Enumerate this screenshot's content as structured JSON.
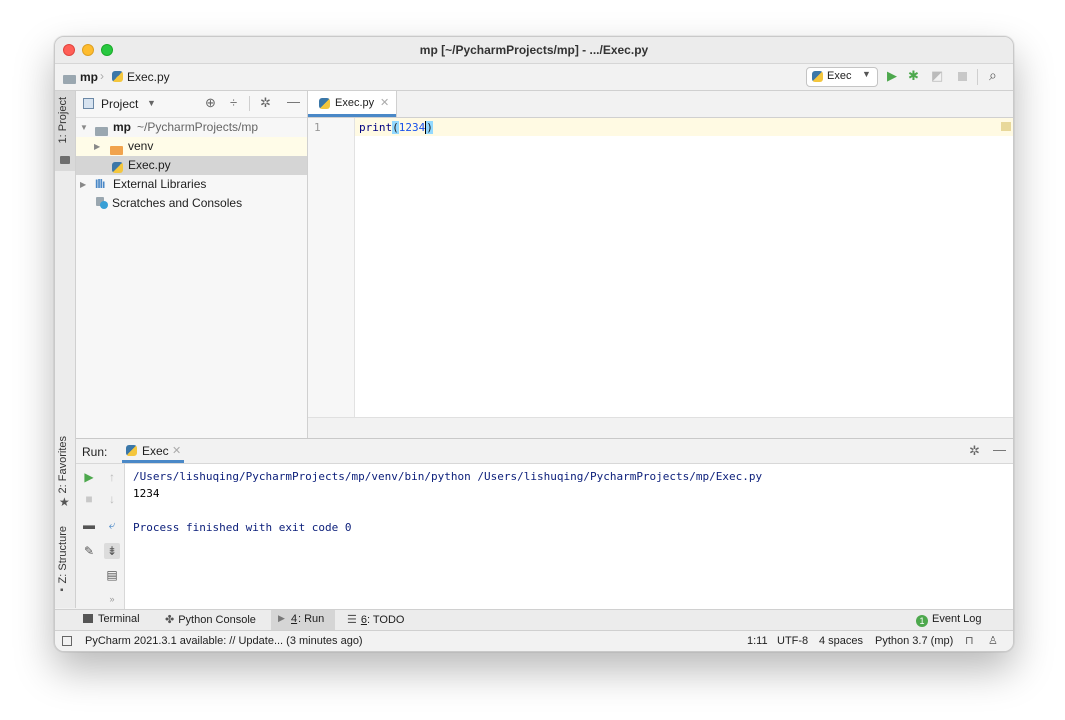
{
  "window": {
    "title": "mp [~/PycharmProjects/mp] - .../Exec.py"
  },
  "navbar": {
    "project": "mp",
    "file": "Exec.py",
    "run_config": "Exec"
  },
  "left_strip": {
    "project": "1: Project",
    "favorites": "2: Favorites",
    "structure": "Z: Structure"
  },
  "project_panel": {
    "title": "Project",
    "tree": [
      {
        "label": "mp",
        "sub": "~/PycharmProjects/mp"
      },
      {
        "label": "venv"
      },
      {
        "label": "Exec.py"
      },
      {
        "label": "External Libraries"
      },
      {
        "label": "Scratches and Consoles"
      }
    ]
  },
  "editor": {
    "tab": "Exec.py",
    "line_number": "1",
    "code_func": "print",
    "code_open": "(",
    "code_num": "1234",
    "code_close": ")"
  },
  "run_panel": {
    "label": "Run:",
    "tab": "Exec",
    "console": [
      "/Users/lishuqing/PycharmProjects/mp/venv/bin/python /Users/lishuqing/PycharmProjects/mp/Exec.py",
      "1234",
      "",
      "Process finished with exit code 0"
    ]
  },
  "bottom_tabs": {
    "terminal": "Terminal",
    "python_console": "Python Console",
    "run_num": "4",
    "run_text": ": Run",
    "todo_num": "6",
    "todo_text": ": TODO",
    "event_log": "Event Log",
    "event_count": "1"
  },
  "status": {
    "message": "PyCharm 2021.3.1 available: // Update... (3 minutes ago)",
    "position": "1:11",
    "encoding": "UTF-8",
    "indent": "4 spaces",
    "interpreter": "Python 3.7 (mp)"
  },
  "colors": {
    "accent": "#4a88c7",
    "run_green": "#4da84d",
    "console_blue": "#0b1e7a",
    "current_line": "#fffae3"
  }
}
